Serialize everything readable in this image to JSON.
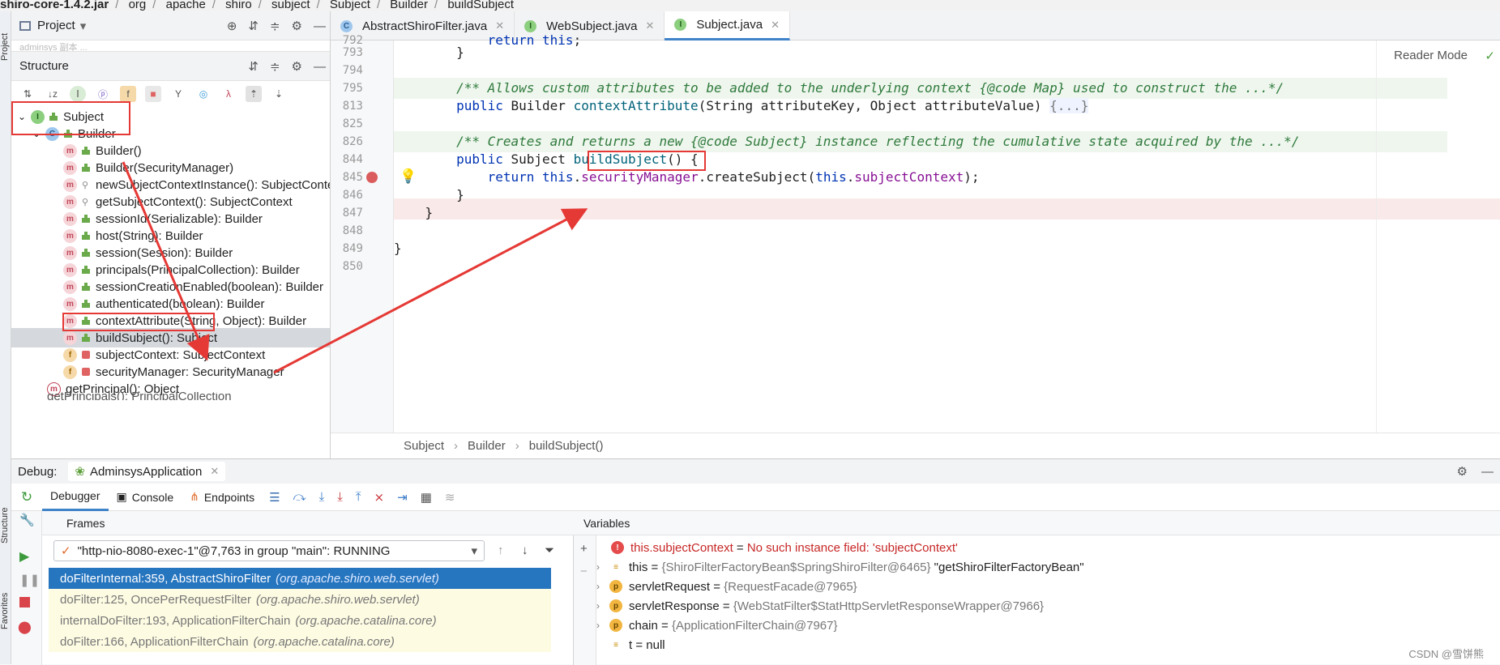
{
  "breadcrumb": {
    "jar": "shiro-core-1.4.2.jar",
    "p1": "org",
    "p2": "apache",
    "p3": "shiro",
    "p4": "subject",
    "p5": "Subject",
    "p6": "Builder",
    "p7": "buildSubject"
  },
  "stripe": {
    "project": "Project",
    "structure": "Structure",
    "favorites": "Favorites"
  },
  "project_panel": {
    "title": "Project",
    "dropdown": "▾",
    "hidden_row": "adminsys  副本 ..."
  },
  "structure_panel": {
    "title": "Structure"
  },
  "tree": {
    "root": "Subject",
    "builder": "Builder",
    "items": [
      "Builder()",
      "Builder(SecurityManager)",
      "newSubjectContextInstance(): SubjectContext",
      "getSubjectContext(): SubjectContext",
      "sessionId(Serializable): Builder",
      "host(String): Builder",
      "session(Session): Builder",
      "principals(PrincipalCollection): Builder",
      "sessionCreationEnabled(boolean): Builder",
      "authenticated(boolean): Builder",
      "contextAttribute(String, Object): Builder",
      "buildSubject(): Subject"
    ],
    "fields": [
      "subjectContext: SubjectContext",
      "securityManager: SecurityManager"
    ],
    "outer": "getPrincipal(): Object",
    "outer2": "getPrincipals(): PrincipalCollection"
  },
  "tabs": [
    {
      "label": "AbstractShiroFilter.java"
    },
    {
      "label": "WebSubject.java"
    },
    {
      "label": "Subject.java"
    }
  ],
  "editor": {
    "reader_mode": "Reader Mode",
    "lines": [
      {
        "n": "792",
        "text": "            return this;"
      },
      {
        "n": "793",
        "text": "        }"
      },
      {
        "n": "794",
        "text": ""
      },
      {
        "n": "795",
        "text": "        /** Allows custom attributes to be added to the underlying context {@code Map} used to construct the ...*/"
      },
      {
        "n": "813",
        "text": "        public Builder contextAttribute(String attributeKey, Object attributeValue) {...}"
      },
      {
        "n": "825",
        "text": ""
      },
      {
        "n": "826",
        "text": "        /** Creates and returns a new {@code Subject} instance reflecting the cumulative state acquired by the ...*/"
      },
      {
        "n": "844",
        "text": "        public Subject buildSubject() {"
      },
      {
        "n": "845",
        "text": "            return this.securityManager.createSubject(this.subjectContext);"
      },
      {
        "n": "846",
        "text": "        }"
      },
      {
        "n": "847",
        "text": "    }"
      },
      {
        "n": "848",
        "text": ""
      },
      {
        "n": "849",
        "text": "}"
      },
      {
        "n": "850",
        "text": ""
      }
    ],
    "breadcrumb": [
      "Subject",
      "Builder",
      "buildSubject()"
    ]
  },
  "debug": {
    "label": "Debug:",
    "config": "AdminsysApplication",
    "tabs": [
      "Debugger",
      "Console",
      "Endpoints"
    ],
    "frames_title": "Frames",
    "variables_title": "Variables",
    "thread": "\"http-nio-8080-exec-1\"@7,763 in group \"main\": RUNNING",
    "frames": [
      {
        "method": "doFilterInternal:359, AbstractShiroFilter",
        "pkg": "(org.apache.shiro.web.servlet)"
      },
      {
        "method": "doFilter:125, OncePerRequestFilter",
        "pkg": "(org.apache.shiro.web.servlet)"
      },
      {
        "method": "internalDoFilter:193, ApplicationFilterChain",
        "pkg": "(org.apache.catalina.core)"
      },
      {
        "method": "doFilter:166, ApplicationFilterChain",
        "pkg": "(org.apache.catalina.core)"
      }
    ],
    "vars": [
      {
        "name": "this.subjectContext",
        "eq": " = ",
        "value": "No such instance field: 'subjectContext'"
      },
      {
        "name": "this",
        "eq": " = ",
        "value": "{ShiroFilterFactoryBean$SpringShiroFilter@6465}",
        "extra": " \"getShiroFilterFactoryBean\""
      },
      {
        "name": "servletRequest",
        "eq": " = ",
        "value": "{RequestFacade@7965}"
      },
      {
        "name": "servletResponse",
        "eq": " = ",
        "value": "{WebStatFilter$StatHttpServletResponseWrapper@7966}"
      },
      {
        "name": "chain",
        "eq": " = ",
        "value": "{ApplicationFilterChain@7967}"
      },
      {
        "name": "t",
        "eq": " = ",
        "value": "null"
      }
    ]
  },
  "watermark": "CSDN @雪饼熊",
  "colors": {
    "accent": "#4083c9",
    "highlight": "#e53935",
    "selected_frame": "#2675bf"
  }
}
